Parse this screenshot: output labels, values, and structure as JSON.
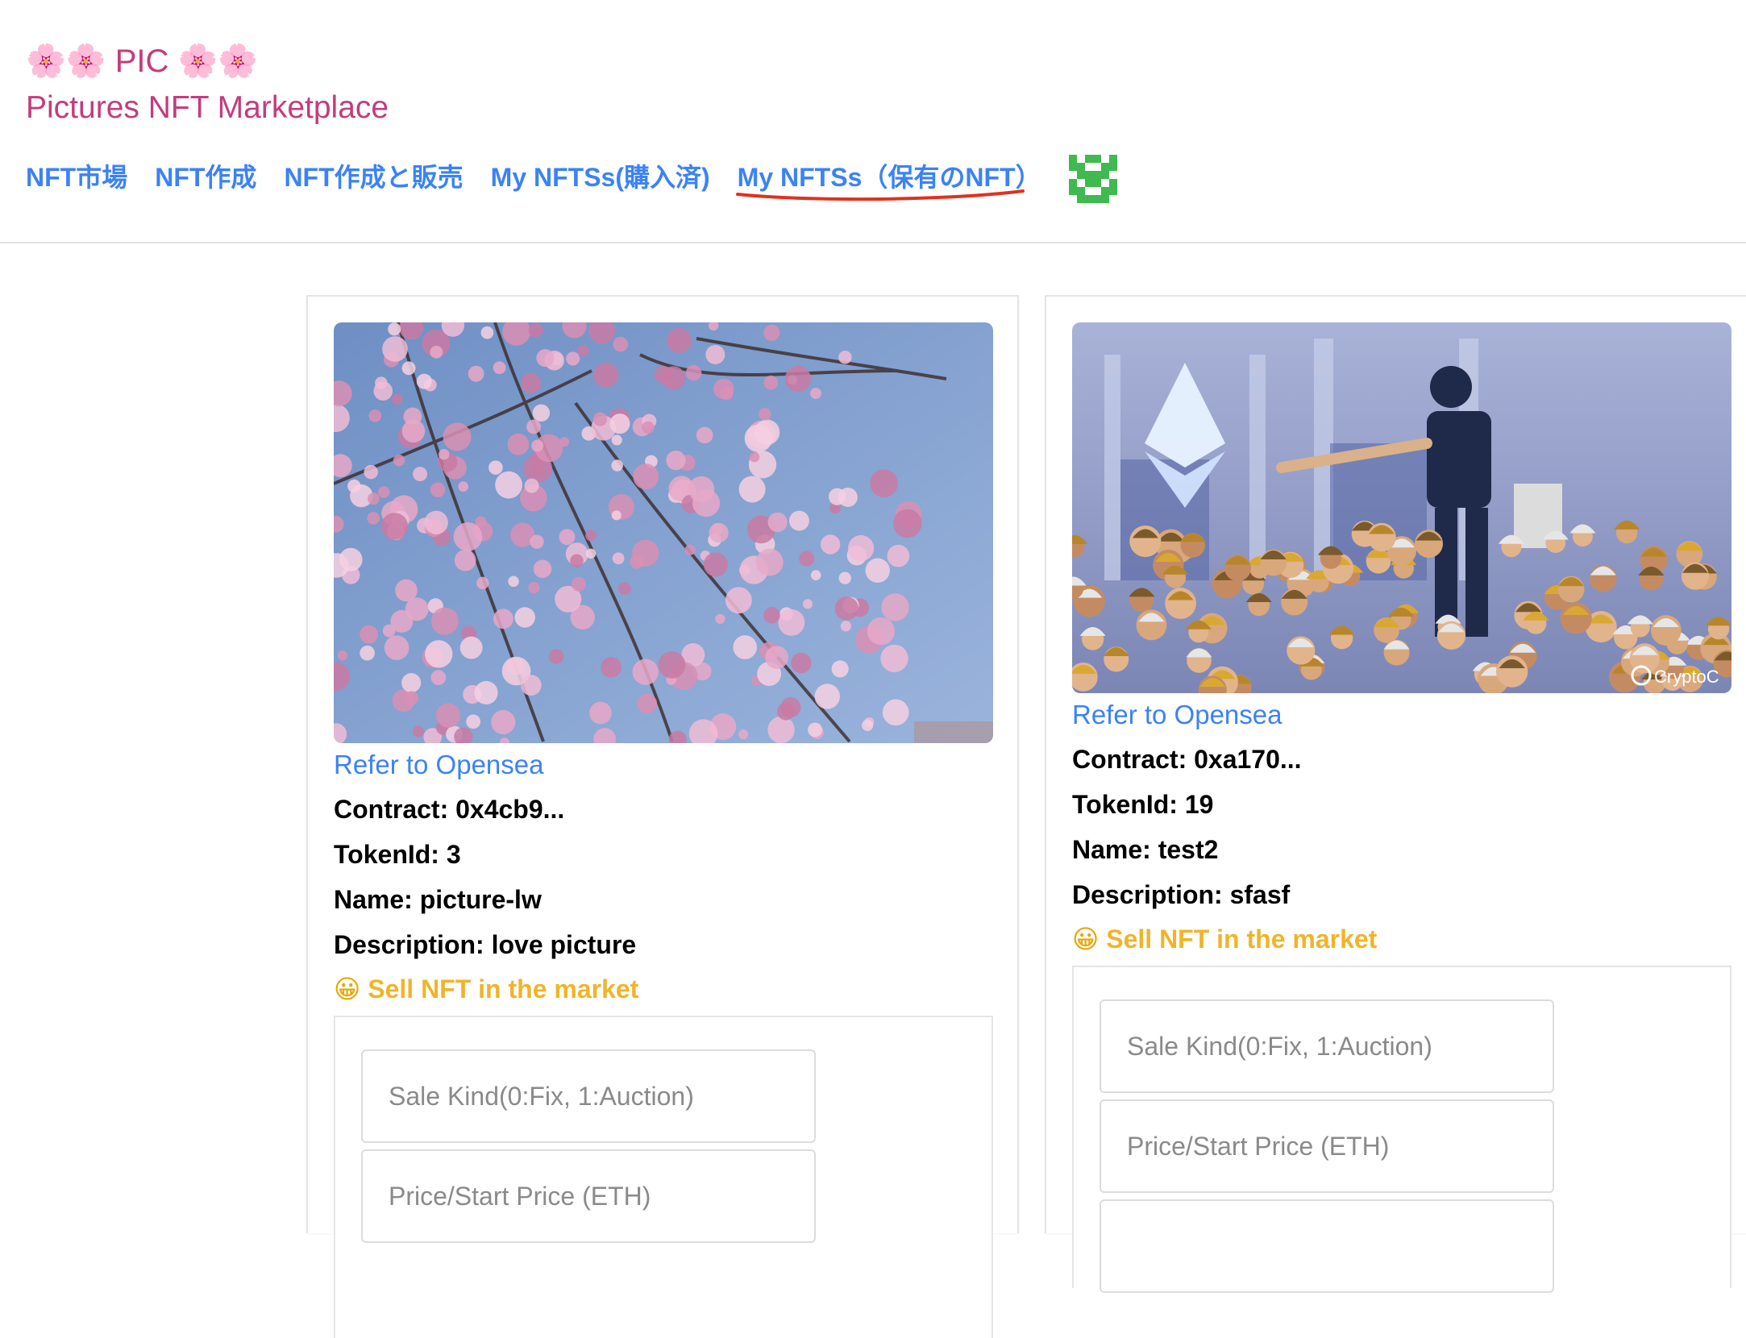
{
  "header": {
    "brand_title": "🌸🌸 PIC 🌸🌸",
    "brand_subtitle": "Pictures NFT Marketplace"
  },
  "nav": {
    "items": [
      {
        "label": "NFT市場"
      },
      {
        "label": "NFT作成"
      },
      {
        "label": "NFT作成と販売"
      },
      {
        "label": "My NFTSs(購入済)"
      },
      {
        "label": "My NFTSs（保有のNFT）"
      }
    ],
    "active_index": 4
  },
  "cards": [
    {
      "link_label": "Refer to Opensea",
      "contract": "Contract: 0x4cb9...",
      "token_id": "TokenId: 3",
      "name": "Name: picture-lw",
      "description": "Description: love picture",
      "sell_label": "Sell NFT in the market",
      "sale_kind_placeholder": "Sale Kind(0:Fix, 1:Auction)",
      "price_placeholder": "Price/Start Price (ETH)"
    },
    {
      "link_label": "Refer to Opensea",
      "contract": "Contract: 0xa170...",
      "token_id": "TokenId: 19",
      "name": "Name: test2",
      "description": "Description: sfasf",
      "sell_label": "Sell NFT in the market",
      "sale_kind_placeholder": "Sale Kind(0:Fix, 1:Auction)",
      "price_placeholder": "Price/Start Price (ETH)",
      "image_watermark": "CryptoC"
    }
  ],
  "colors": {
    "brand": "#c43c7c",
    "link": "#3b82f6",
    "sell": "#f0b429",
    "avatar": "#3fb950"
  }
}
